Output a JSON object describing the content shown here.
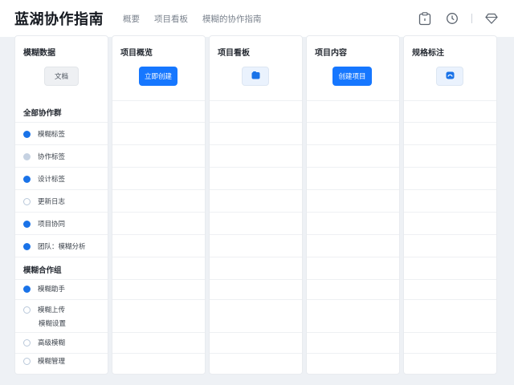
{
  "header": {
    "title": "蓝湖协作指南",
    "nav": [
      "概要",
      "项目看板",
      "模糊的协作指南"
    ]
  },
  "icons": {
    "toolbar": [
      "clipboard-icon",
      "clock-icon",
      "diamond-icon"
    ],
    "accent": "#1677ff"
  },
  "columns": [
    {
      "title": "模糊数据",
      "button": "文档"
    },
    {
      "title": "项目概览",
      "button": "立即创建"
    },
    {
      "title": "项目看板",
      "button": ""
    },
    {
      "title": "项目内容",
      "button": "创建项目"
    },
    {
      "title": "规格标注",
      "button": ""
    }
  ],
  "sidebar": {
    "section1": "全部协作群",
    "items1": [
      "模糊标签",
      "协作标签",
      "设计标签",
      "更新日志",
      "项目协同",
      "团队：模糊分析"
    ],
    "section2": "模糊合作组",
    "items2": [
      "模糊助手",
      "模糊上传",
      "高级模糊",
      "模糊管理"
    ],
    "item2_sub": "模糊设置"
  }
}
